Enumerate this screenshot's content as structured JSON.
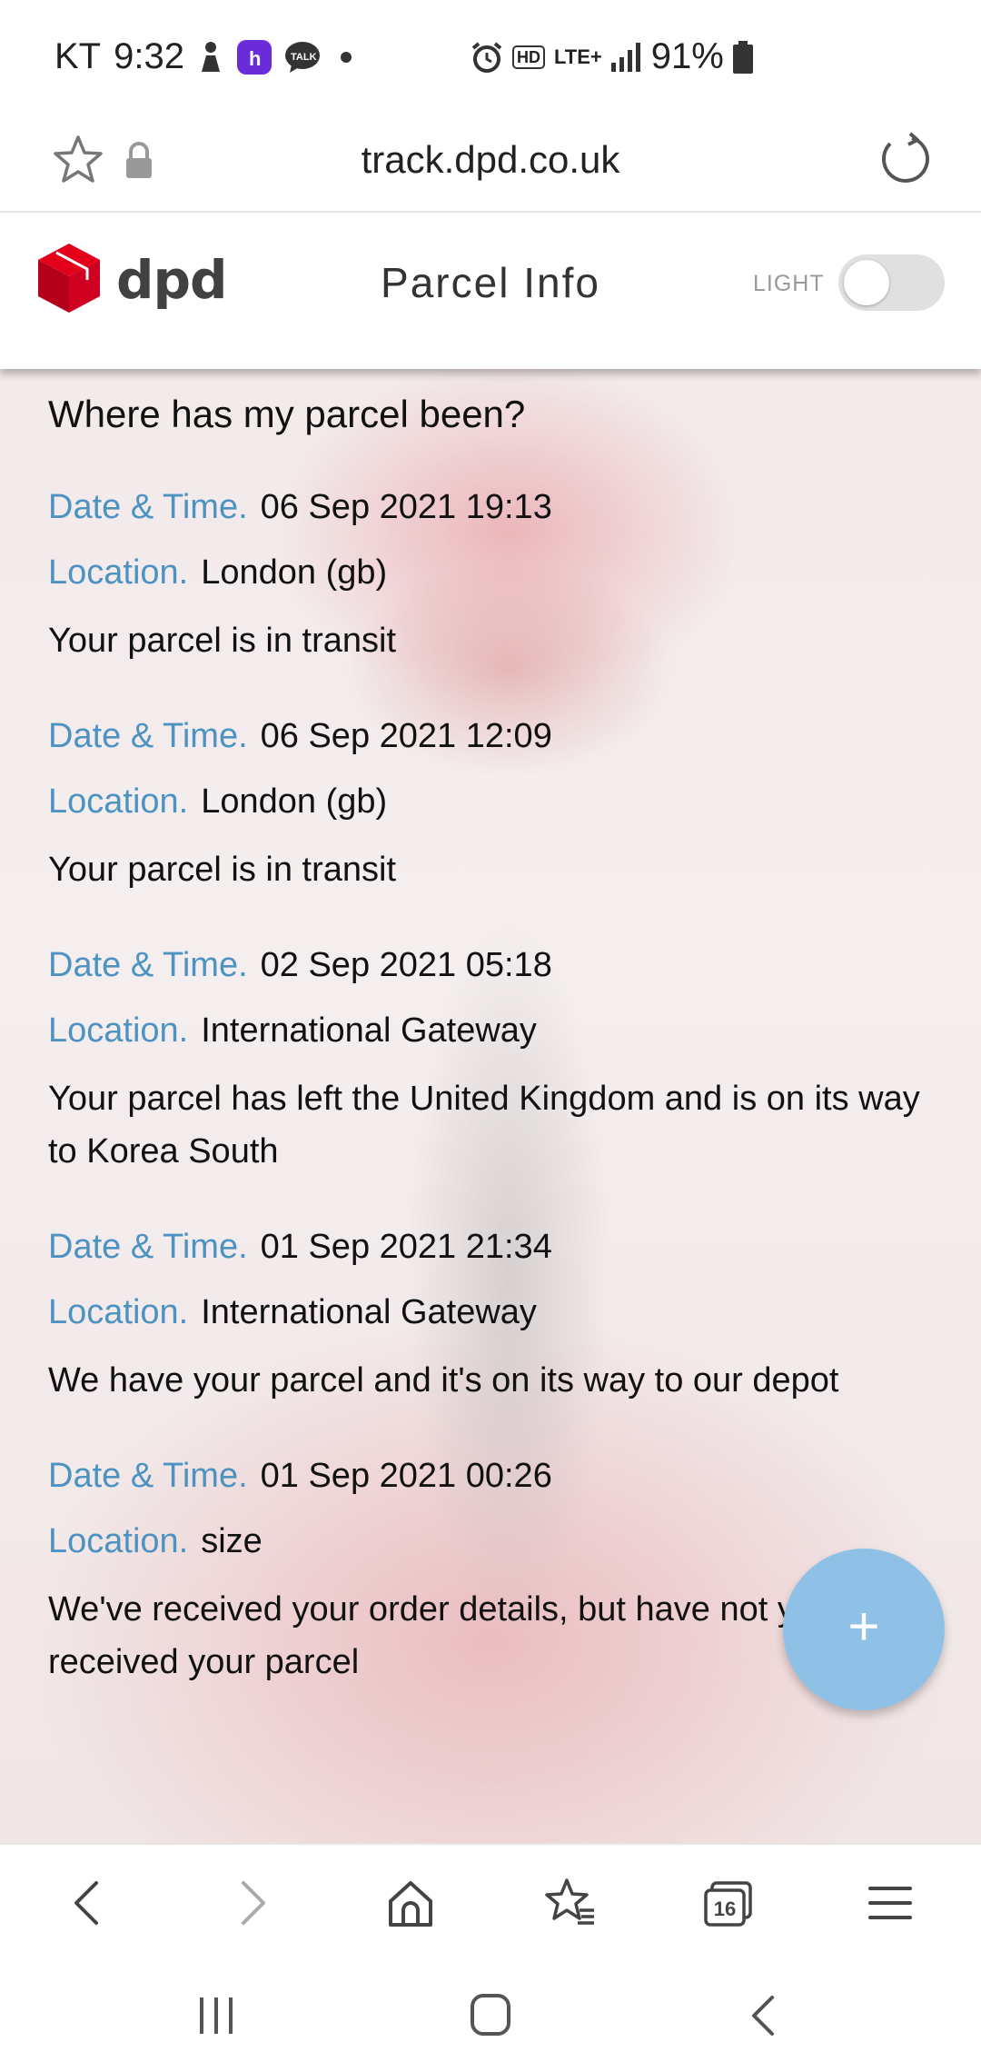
{
  "status_bar": {
    "carrier": "KT",
    "time": "9:32",
    "hd_badge": "HD",
    "network": "LTE+",
    "battery": "91%"
  },
  "browser": {
    "url": "track.dpd.co.uk",
    "tab_count": "16"
  },
  "header": {
    "logo_text": "dpd",
    "title": "Parcel Info",
    "theme_label": "LIGHT",
    "theme_toggle_on": false
  },
  "tracking": {
    "heading": "Where has my parcel been?",
    "date_label": "Date & Time.",
    "location_label": "Location.",
    "events": [
      {
        "datetime": "06 Sep 2021 19:13",
        "location": "London (gb)",
        "description": "Your parcel is in transit"
      },
      {
        "datetime": "06 Sep 2021 12:09",
        "location": "London (gb)",
        "description": "Your parcel is in transit"
      },
      {
        "datetime": "02 Sep 2021 05:18",
        "location": "International Gateway",
        "description": "Your parcel has left the United Kingdom and is on its way to Korea South"
      },
      {
        "datetime": "01 Sep 2021 21:34",
        "location": "International Gateway",
        "description": "We have your parcel and it's on its way to our depot"
      },
      {
        "datetime": "01 Sep 2021 00:26",
        "location": "size",
        "description": "We've received your order details, but have not yet received your parcel"
      }
    ]
  },
  "fab": {
    "label": "+"
  },
  "colors": {
    "dpd_red": "#dc0032",
    "label_blue": "#4d93c2",
    "fab_blue": "#8fc1e6"
  },
  "icons": [
    "star-icon",
    "lock-icon",
    "reload-icon",
    "dpd-cube-logo",
    "back-icon",
    "forward-icon",
    "home-icon",
    "bookmarks-icon",
    "tabs-icon",
    "menu-icon",
    "recents-icon",
    "home-circle-icon",
    "nav-back-icon"
  ]
}
